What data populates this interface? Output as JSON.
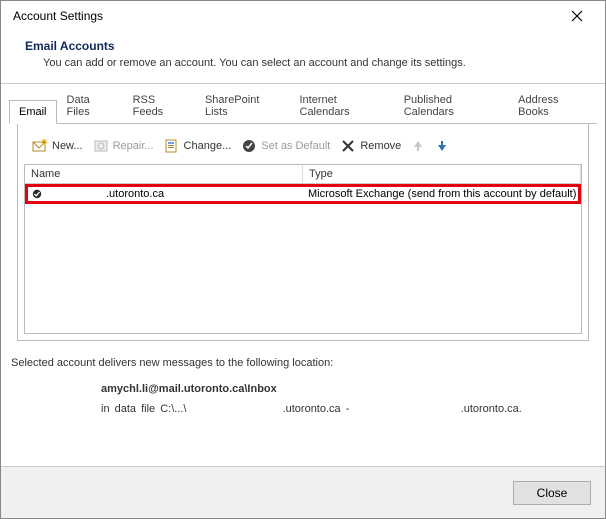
{
  "window": {
    "title": "Account Settings"
  },
  "header": {
    "title": "Email Accounts",
    "subtitle": "You can add or remove an account. You can select an account and change its settings."
  },
  "tabs": {
    "email": "Email",
    "dataFiles": "Data Files",
    "rssFeeds": "RSS Feeds",
    "sharepoint": "SharePoint Lists",
    "internetCal": "Internet Calendars",
    "publishedCal": "Published Calendars",
    "addressBooks": "Address Books"
  },
  "toolbar": {
    "new": "New...",
    "repair": "Repair...",
    "change": "Change...",
    "setDefault": "Set as Default",
    "remove": "Remove"
  },
  "columns": {
    "name": "Name",
    "type": "Type"
  },
  "accounts": [
    {
      "name": ".utoronto.ca",
      "type": "Microsoft Exchange (send from this account by default)",
      "checked": true
    }
  ],
  "location": {
    "intro": "Selected account delivers new messages to the following location:",
    "mailbox": "amychl.li@mail.utoronto.ca\\Inbox",
    "path_prefix": "in data file C:\\...\\",
    "path_mid": ".utoronto.ca -",
    "path_suffix": ".utoronto.ca."
  },
  "footer": {
    "close": "Close"
  }
}
